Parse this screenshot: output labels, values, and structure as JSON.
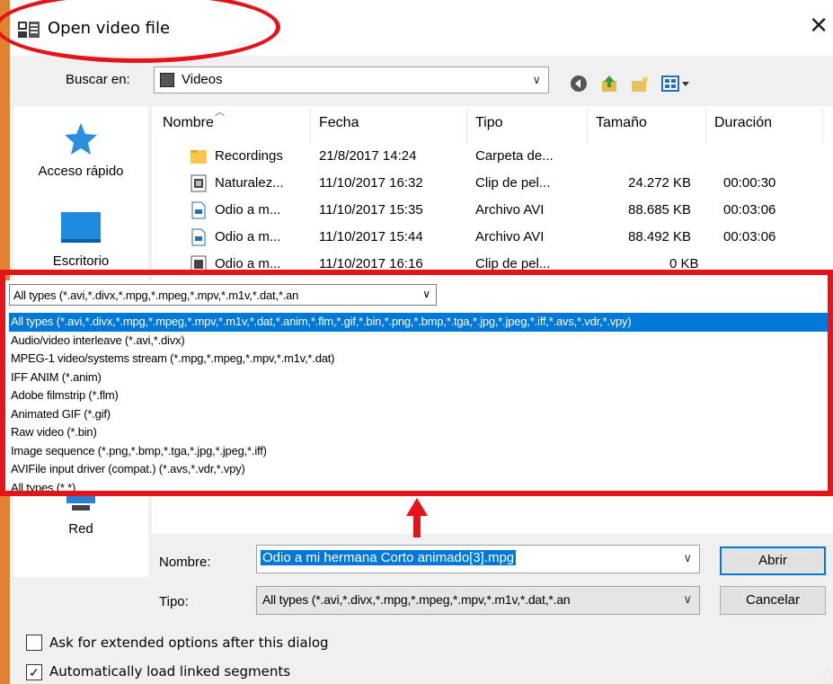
{
  "window": {
    "title": "Open video file"
  },
  "lookin": {
    "label": "Buscar en:",
    "value": "Videos"
  },
  "places": [
    {
      "label": "Acceso rápido",
      "icon": "star-icon"
    },
    {
      "label": "Escritorio",
      "icon": "desktop-icon"
    },
    {
      "label": "Red",
      "icon": "network-icon"
    }
  ],
  "columns": [
    "Nombre",
    "Fecha",
    "Tipo",
    "Tamaño",
    "Duración"
  ],
  "files": [
    {
      "name": "Recordings",
      "date": "21/8/2017 14:24",
      "type": "Carpeta de...",
      "size": "",
      "duration": "",
      "icon": "folder-icon"
    },
    {
      "name": "Naturalez...",
      "date": "11/10/2017 16:32",
      "type": "Clip de pel...",
      "size": "24.272 KB",
      "duration": "00:00:30",
      "icon": "video-file-icon"
    },
    {
      "name": "Odio a m...",
      "date": "11/10/2017 15:35",
      "type": "Archivo AVI",
      "size": "88.685 KB",
      "duration": "00:03:06",
      "icon": "avi-file-icon"
    },
    {
      "name": "Odio a m...",
      "date": "11/10/2017 15:44",
      "type": "Archivo AVI",
      "size": "88.492 KB",
      "duration": "00:03:06",
      "icon": "avi-file-icon"
    },
    {
      "name": "Odio a m...",
      "date": "11/10/2017 16:16",
      "type": "Clip de pel...",
      "size": "0 KB",
      "duration": "",
      "icon": "video-file-icon"
    }
  ],
  "filetype_dropdown": {
    "selected": "All types (*.avi,*.divx,*.mpg,*.mpeg,*.mpv,*.m1v,*.dat,*.an",
    "options": [
      "All types (*.avi,*.divx,*.mpg,*.mpeg,*.mpv,*.m1v,*.dat,*.anim,*.flm,*.gif,*.bin,*.png,*.bmp,*.tga,*.jpg,*.jpeg,*.iff,*.avs,*.vdr,*.vpy)",
      "Audio/video interleave (*.avi,*.divx)",
      "MPEG-1 video/systems stream (*.mpg,*.mpeg,*.mpv,*.m1v,*.dat)",
      "IFF ANIM (*.anim)",
      "Adobe filmstrip (*.flm)",
      "Animated GIF (*.gif)",
      "Raw video (*.bin)",
      "Image sequence (*.png,*.bmp,*.tga,*.jpg,*.jpeg,*.iff)",
      "AVIFile input driver (compat.) (*.avs,*.vdr,*.vpy)",
      "All types (*.*)"
    ],
    "selected_index": 0
  },
  "filename": {
    "label": "Nombre:",
    "value": "Odio a mi hermana  Corto animado[3].mpg"
  },
  "filetype": {
    "label": "Tipo:",
    "value": "All types (*.avi,*.divx,*.mpg,*.mpeg,*.mpv,*.m1v,*.dat,*.an"
  },
  "buttons": {
    "open": "Abrir",
    "cancel": "Cancelar"
  },
  "options": [
    {
      "label": "Ask for extended options after this dialog",
      "checked": false
    },
    {
      "label": "Automatically load linked segments",
      "checked": true
    }
  ],
  "colors": {
    "accent": "#0078d7",
    "annotation": "#e3141a",
    "background": "#e2822e"
  }
}
